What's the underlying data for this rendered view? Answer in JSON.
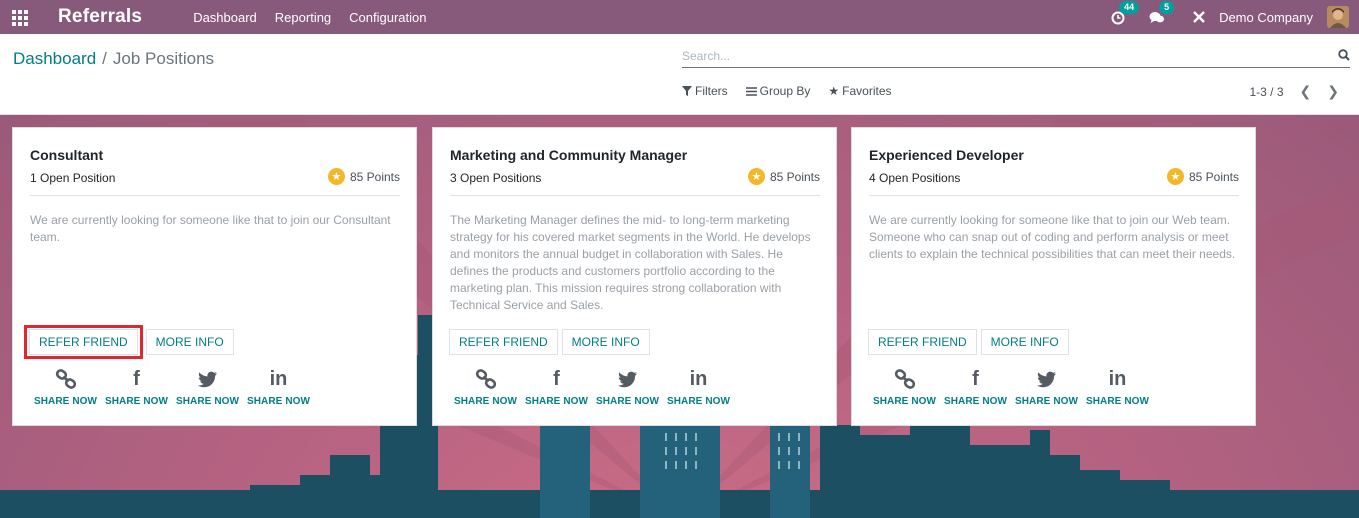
{
  "navbar": {
    "app_name": "Referrals",
    "menu": [
      "Dashboard",
      "Reporting",
      "Configuration"
    ],
    "activity_count": "44",
    "messages_count": "5",
    "company": "Demo Company"
  },
  "breadcrumb": {
    "parent": "Dashboard",
    "separator": "/",
    "current": "Job Positions"
  },
  "search": {
    "placeholder": "Search..."
  },
  "filters": {
    "filters": "Filters",
    "group_by": "Group By",
    "favorites": "Favorites"
  },
  "pager": {
    "text": "1-3 / 3"
  },
  "colors": {
    "navbar": "#875a7b",
    "accent": "#017e84",
    "highlight": "#e0262f",
    "star": "#f3b72a"
  },
  "cards": [
    {
      "title": "Consultant",
      "positions": "1 Open Position",
      "points": "85 Points",
      "description": "We are currently looking for someone like that to join our Consultant team.",
      "refer_label": "REFER FRIEND",
      "more_label": "MORE INFO",
      "share_label": "SHARE NOW"
    },
    {
      "title": "Marketing and Community Manager",
      "positions": "3 Open Positions",
      "points": "85 Points",
      "description": "The Marketing Manager defines the mid- to long-term marketing strategy for his covered market segments in the World. He develops and monitors the annual budget in collaboration with Sales. He defines the products and customers portfolio according to the marketing plan. This mission requires strong collaboration with Technical Service and Sales.",
      "refer_label": "REFER FRIEND",
      "more_label": "MORE INFO",
      "share_label": "SHARE NOW"
    },
    {
      "title": "Experienced Developer",
      "positions": "4 Open Positions",
      "points": "85 Points",
      "description": "We are currently looking for someone like that to join our Web team. Someone who can snap out of coding and perform analysis or meet clients to explain the technical possibilities that can meet their needs.",
      "refer_label": "REFER FRIEND",
      "more_label": "MORE INFO",
      "share_label": "SHARE NOW"
    }
  ],
  "share_icons": [
    "link-icon",
    "facebook-icon",
    "twitter-icon",
    "linkedin-icon"
  ]
}
